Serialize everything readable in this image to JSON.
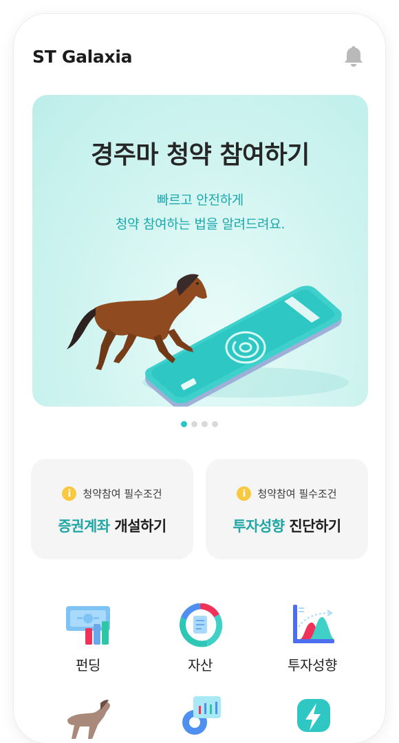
{
  "app": {
    "title": "ST Galaxia"
  },
  "header": {
    "bell_icon": "bell-icon"
  },
  "banner": {
    "title": "경주마 청약 참여하기",
    "subtitle_line1": "빠르고 안전하게",
    "subtitle_line2": "청약 참여하는 법을 알려드려요.",
    "illustration": "horse-and-phone-illustration",
    "pagination": {
      "total": 4,
      "active": 1
    }
  },
  "cards": [
    {
      "requirement": "청약참여 필수조건",
      "highlight": "증권계좌",
      "rest": " 개설하기",
      "icon": "info-icon"
    },
    {
      "requirement": "청약참여 필수조건",
      "highlight": "투자성향",
      "rest": " 진단하기",
      "icon": "info-icon"
    }
  ],
  "menu": [
    {
      "label": "펀딩",
      "icon": "funding-icon"
    },
    {
      "label": "자산",
      "icon": "assets-icon"
    },
    {
      "label": "투자성향",
      "icon": "investment-tendency-icon"
    },
    {
      "label": "",
      "icon": "horse-icon"
    },
    {
      "label": "",
      "icon": "settings-chart-icon"
    },
    {
      "label": "",
      "icon": "lightning-icon"
    }
  ],
  "colors": {
    "accent": "#2bc4c7",
    "highlight_text": "#20a6a4",
    "banner_bg": "#c8f1ed",
    "card_bg": "#f5f5f5",
    "info_icon": "#f8c940"
  }
}
